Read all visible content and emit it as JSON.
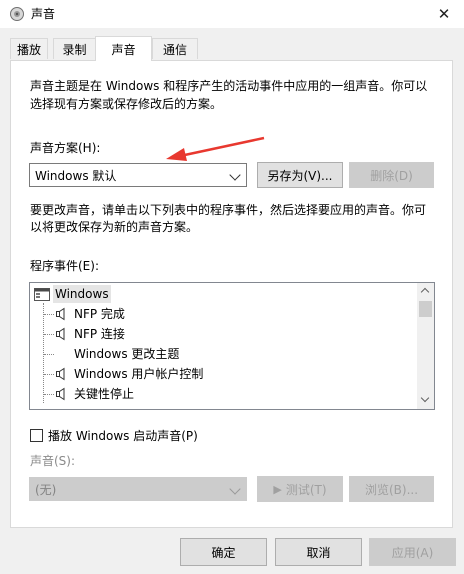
{
  "window": {
    "title": "声音",
    "close_symbol": "✕"
  },
  "tabs": [
    {
      "label": "播放"
    },
    {
      "label": "录制"
    },
    {
      "label": "声音"
    },
    {
      "label": "通信"
    }
  ],
  "active_tab": "声音",
  "intro_text": [
    "声音主题是在 Windows 和程序产生的活动事件中应用的一组声音。你可以",
    "选择现有方案或保存修改后的方案。"
  ],
  "scheme": {
    "label": "声音方案(H):",
    "selected": "Windows 默认",
    "save_as_button": "另存为(V)...",
    "delete_button": "删除(D)"
  },
  "change_text": [
    "要更改声音，请单击以下列表中的程序事件，然后选择要应用的声音。你可",
    "以将更改保存为新的声音方案。"
  ],
  "events": {
    "label": "程序事件(E):",
    "items": [
      {
        "label": "Windows",
        "type": "group"
      },
      {
        "label": "NFP 完成",
        "has_sound": true
      },
      {
        "label": "NFP 连接",
        "has_sound": true
      },
      {
        "label": "Windows 更改主题",
        "has_sound": false
      },
      {
        "label": "Windows 用户帐户控制",
        "has_sound": true
      },
      {
        "label": "关键性停止",
        "has_sound": true
      }
    ]
  },
  "startup_sound": {
    "label": "播放 Windows 启动声音(P)",
    "checked": false
  },
  "sound": {
    "label": "声音(S):",
    "selected": "(无)",
    "test_button": "测试(T)",
    "test_symbol": "▶",
    "browse_button": "浏览(B)..."
  },
  "footer": {
    "ok": "确定",
    "cancel": "取消",
    "apply": "应用(A)"
  },
  "colors": {
    "annotation_arrow": "#e8382f"
  }
}
